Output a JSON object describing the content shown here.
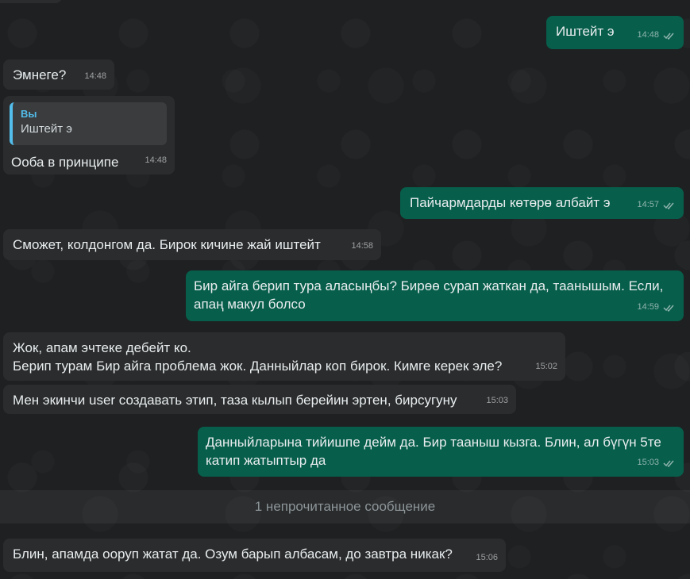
{
  "messages": [
    {
      "id": "m1",
      "direction": "out",
      "text": "Иштейт э",
      "time": "14:48",
      "status": "read"
    },
    {
      "id": "m2",
      "direction": "in",
      "text": "Эмнеге?",
      "time": "14:48"
    },
    {
      "id": "m3",
      "direction": "in",
      "reply": {
        "author": "Вы",
        "text": "Иштейт э"
      },
      "text": "Ooба в принципе",
      "time": "14:48"
    },
    {
      "id": "m4",
      "direction": "out",
      "text": "Пайчармдарды көтөрө албайт э",
      "time": "14:57",
      "status": "read"
    },
    {
      "id": "m5",
      "direction": "in",
      "text": "Сможет, колдонгом да. Бирок кичине жай иштейт",
      "time": "14:58"
    },
    {
      "id": "m6",
      "direction": "out",
      "text": "Бир айга берип тура аласыңбы? Бирөө сурап жаткан да, таанышым. Если,\nапаң макул болсо",
      "time": "14:59",
      "status": "read"
    },
    {
      "id": "m7",
      "direction": "in",
      "text": "Жок, апам эчтеке дебейт ко.\nБерип турам Бир айга проблема жок. Данныйлар коп бирок. Кимге керек эле?",
      "time": "15:02"
    },
    {
      "id": "m8",
      "direction": "in",
      "text": "Мен экинчи user создавать этип, таза кылып берейин эртен, бирсугуну",
      "time": "15:03"
    },
    {
      "id": "m9",
      "direction": "out",
      "text": "Данныйларына тийишпе дейм да. Бир тааныш кызга. Блин, ал бүгүн 5те\nкатип жатыптыр да",
      "time": "15:03",
      "status": "read"
    },
    {
      "id": "m10",
      "direction": "in",
      "text": "Блин, апамда ооруп жатат да. Озум барып албасам, до завтра никак?",
      "time": "15:06"
    }
  ],
  "unread_banner": "1 непрочитанное сообщение",
  "colors": {
    "incoming_bubble": "#2a2c2d",
    "outgoing_bubble": "#075e4b",
    "reply_accent": "#53bdeb",
    "background": "#1e2021"
  },
  "icons": {
    "read_receipt": "double-check-icon"
  }
}
